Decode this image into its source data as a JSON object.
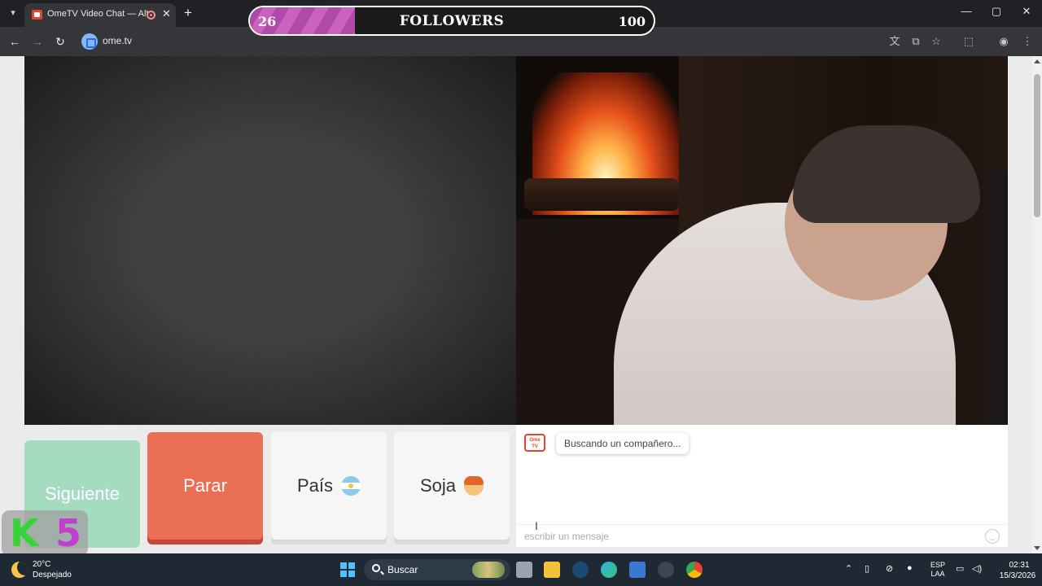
{
  "browser": {
    "tab_title": "OmeTV Video Chat — Alter",
    "tab_close": "✕",
    "new_tab": "+",
    "url": "ome.tv",
    "window_controls": {
      "minimize": "—",
      "maximize": "▢",
      "close": "✕"
    }
  },
  "followers": {
    "current": "26",
    "label": "FOLLOWERS",
    "goal": "100",
    "progress_fraction": 0.26
  },
  "controls": {
    "next_label": "Siguiente",
    "stop_label": "Parar",
    "country_label": "País",
    "gender_label": "Soja"
  },
  "chat": {
    "logo_text": "Ome TV",
    "status_message": "Buscando un compañero...",
    "input_placeholder": "escribir un mensaje"
  },
  "overlay": {
    "k_letter": "K",
    "number": "5"
  },
  "taskbar": {
    "weather_temp": "20°C",
    "weather_desc": "Despejado",
    "search_label": "Buscar",
    "language_top": "ESP",
    "language_bottom": "LAA",
    "time": "02:31",
    "date": "15/3/2026"
  },
  "icons": {
    "back": "back-arrow-icon",
    "forward": "forward-arrow-icon",
    "reload": "reload-icon",
    "translate": "translate-icon",
    "star": "star-icon",
    "extensions": "extensions-icon",
    "profile": "profile-icon"
  },
  "colors": {
    "stop_button": "#eb6e57",
    "next_button": "#a5dcc0",
    "followers_fill": "#b04aa8",
    "accent": "#e8412c"
  }
}
